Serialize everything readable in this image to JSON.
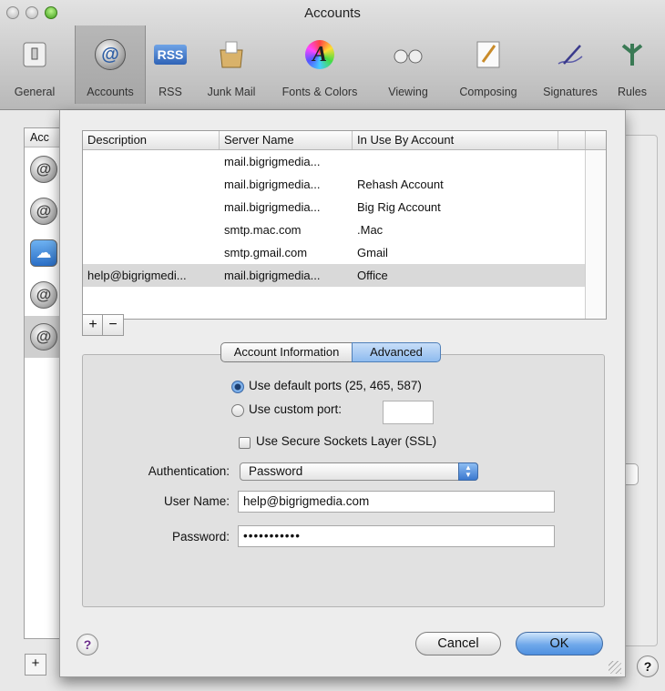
{
  "window": {
    "title": "Accounts"
  },
  "toolbar": {
    "items": [
      {
        "label": "General",
        "icon": "general-switch-icon"
      },
      {
        "label": "Accounts",
        "icon": "at-sign-icon"
      },
      {
        "label": "RSS",
        "icon": "rss-icon"
      },
      {
        "label": "Junk Mail",
        "icon": "junk-mail-icon"
      },
      {
        "label": "Fonts & Colors",
        "icon": "fonts-colors-icon"
      },
      {
        "label": "Viewing",
        "icon": "glasses-icon"
      },
      {
        "label": "Composing",
        "icon": "pencil-paper-icon"
      },
      {
        "label": "Signatures",
        "icon": "pen-icon"
      },
      {
        "label": "Rules",
        "icon": "rules-icon"
      }
    ],
    "rss_badge": "RSS",
    "fonts_glyph": "A",
    "at_glyph": "@"
  },
  "behind": {
    "accounts_header": "Acc",
    "add_label": "+",
    "help_label": "?",
    "account_glyph": "@"
  },
  "sheet": {
    "table": {
      "columns": [
        "Description",
        "Server Name",
        "In Use By Account"
      ],
      "rows": [
        {
          "description": "",
          "server": "mail.bigrigmedia...",
          "account": ""
        },
        {
          "description": "",
          "server": "mail.bigrigmedia...",
          "account": "Rehash Account"
        },
        {
          "description": "",
          "server": "mail.bigrigmedia...",
          "account": "Big Rig Account"
        },
        {
          "description": "",
          "server": "smtp.mac.com",
          "account": ".Mac"
        },
        {
          "description": "",
          "server": "smtp.gmail.com",
          "account": "Gmail"
        },
        {
          "description": "help@bigrigmedi...",
          "server": "mail.bigrigmedia...",
          "account": "Office"
        }
      ],
      "selected_row": 5
    },
    "add_label": "+",
    "remove_label": "−",
    "tabs": {
      "info": "Account Information",
      "advanced": "Advanced",
      "selected": "advanced"
    },
    "ports": {
      "default_label": "Use default ports (25, 465, 587)",
      "custom_label": "Use custom port:",
      "selected": "default",
      "custom_value": ""
    },
    "ssl": {
      "label": "Use Secure Sockets Layer (SSL)",
      "checked": false
    },
    "auth": {
      "label": "Authentication:",
      "value": "Password"
    },
    "username": {
      "label": "User Name:",
      "value": "help@bigrigmedia.com"
    },
    "password": {
      "label": "Password:",
      "value": "•••••••••••"
    },
    "buttons": {
      "cancel": "Cancel",
      "ok": "OK",
      "help": "?"
    }
  }
}
